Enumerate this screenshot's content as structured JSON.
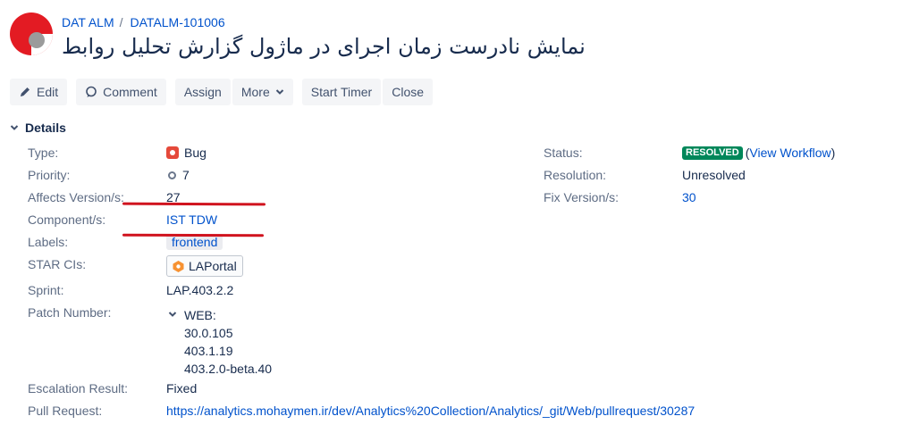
{
  "breadcrumb": {
    "project": "DAT ALM",
    "separator": "/",
    "issue_key": "DATALM-101006"
  },
  "issue": {
    "title": "نمایش نادرست زمان اجرای در ماژول گزارش تحلیل روابط"
  },
  "toolbar": {
    "edit": "Edit",
    "comment": "Comment",
    "assign": "Assign",
    "more": "More",
    "start_timer": "Start Timer",
    "close": "Close"
  },
  "details": {
    "heading": "Details",
    "type_label": "Type:",
    "type_value": "Bug",
    "priority_label": "Priority:",
    "priority_value": "7",
    "affects_label": "Affects Version/s:",
    "affects_value": "27",
    "component_label": "Component/s:",
    "component_value": "IST TDW",
    "labels_label": "Labels:",
    "labels_value": "frontend",
    "star_label": "STAR CIs:",
    "star_value": "LAPortal",
    "sprint_label": "Sprint:",
    "sprint_value": "LAP.403.2.2",
    "patch_label": "Patch Number:",
    "patch_group": "WEB:",
    "patch_values": [
      "30.0.105",
      "403.1.19",
      "403.2.0-beta.40"
    ],
    "escalation_label": "Escalation Result:",
    "escalation_value": "Fixed",
    "pull_label": "Pull Request:",
    "pull_value": "https://analytics.mohaymen.ir/dev/Analytics%20Collection/Analytics/_git/Web/pullrequest/30287",
    "status_label": "Status:",
    "status_value": "RESOLVED",
    "workflow_open": "(",
    "workflow_link": "View Workflow",
    "workflow_close": ")",
    "resolution_label": "Resolution:",
    "resolution_value": "Unresolved",
    "fix_label": "Fix Version/s:",
    "fix_value": "30"
  },
  "colors": {
    "accent": "#0052cc",
    "status_green": "#00875a",
    "annotation_red": "#d0131e",
    "bug_red": "#e5493a"
  }
}
